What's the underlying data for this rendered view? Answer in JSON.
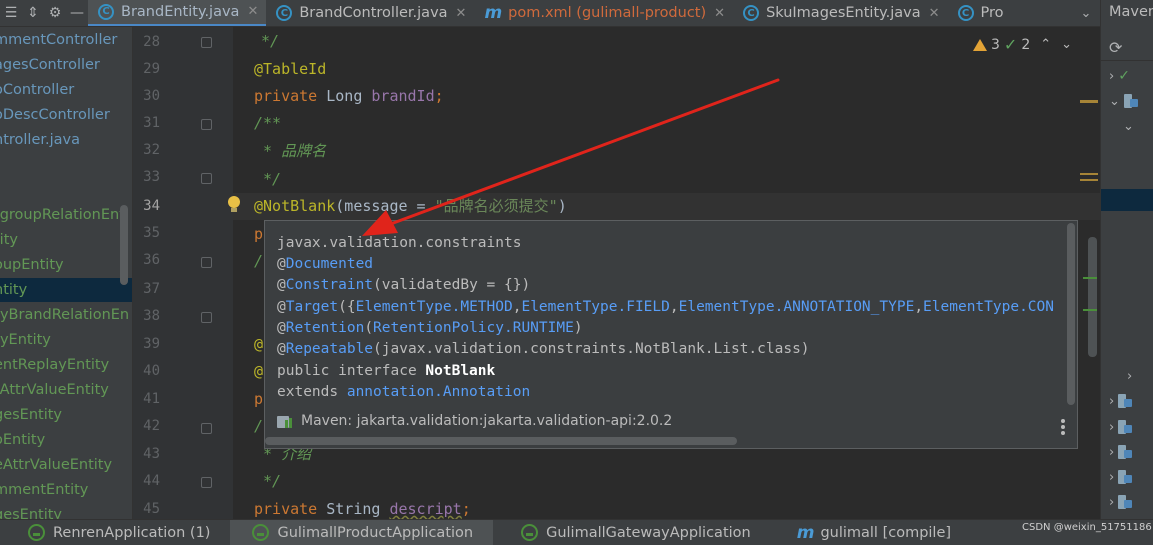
{
  "tabs": [
    {
      "label": "BrandEntity.java",
      "icon": "c-class-icon",
      "active": true
    },
    {
      "label": "BrandController.java",
      "icon": "c-class-icon",
      "active": false
    },
    {
      "label": "pom.xml (gulimall-product)",
      "icon": "maven-m-icon",
      "active": false
    },
    {
      "label": "SkuImagesEntity.java",
      "icon": "c-class-icon",
      "active": false
    },
    {
      "label": "Pro",
      "icon": "c-class-icon",
      "active": false
    }
  ],
  "project_items": [
    {
      "label": "mmentController",
      "color": "blue"
    },
    {
      "label": "agesController",
      "color": "blue"
    },
    {
      "label": "oController",
      "color": "blue"
    },
    {
      "label": "oDescController",
      "color": "blue"
    },
    {
      "label": "ntroller.java",
      "color": "blue"
    },
    {
      "label": "",
      "color": "blue"
    },
    {
      "label": "",
      "color": "blue"
    },
    {
      "label": "rgroupRelationEnt",
      "color": "green"
    },
    {
      "label": "tity",
      "color": "green"
    },
    {
      "label": "oupEntity",
      "color": "green"
    },
    {
      "label": "ntity",
      "color": "green"
    },
    {
      "label": "ryBrandRelationEn",
      "color": "green"
    },
    {
      "label": "ryEntity",
      "color": "green"
    },
    {
      "label": "entReplayEntity",
      "color": "green"
    },
    {
      "label": "tAttrValueEntity",
      "color": "green"
    },
    {
      "label": "gesEntity",
      "color": "green"
    },
    {
      "label": "oEntity",
      "color": "green"
    },
    {
      "label": "eAttrValueEntity",
      "color": "green"
    },
    {
      "label": "mmentEntity",
      "color": "green"
    },
    {
      "label": "gesEntity",
      "color": "green"
    }
  ],
  "line_numbers": [
    "28",
    "29",
    "30",
    "31",
    "32",
    "33",
    "34",
    "35",
    "36",
    "37",
    "38",
    "39",
    "40",
    "41",
    "42",
    "43",
    "44",
    "45"
  ],
  "current_line": "34",
  "code": {
    "l28": "*/",
    "l29": "@TableId",
    "l30_kw": "private",
    "l30_type": " Long ",
    "l30_field": "brandId",
    "l30_end": ";",
    "l31": "/**",
    "l32": " * 品牌名",
    "l33": " */",
    "l34_ann": "@NotBlank",
    "l34_rest": "(message = ",
    "l34_str": "\"品牌名必须提交\"",
    "l34_end": ")",
    "l35": "p",
    "l36": "/",
    "l39": "@",
    "l40": "@",
    "l41": "p",
    "l42": "/",
    "l43": " * 介绍",
    "l44": " */",
    "l45_kw": "private",
    "l45_type": " String ",
    "l45_field": "descript",
    "l45_end": ";"
  },
  "inspection": {
    "warnings": "3",
    "checks": "2"
  },
  "doc": {
    "package": "javax.validation.constraints",
    "at1": "@",
    "documented": "Documented",
    "at2": "@",
    "constraint": "Constraint",
    "constraint_args": "(validatedBy = {})",
    "at3": "@",
    "target": "Target",
    "target_open": "({",
    "et_method": "ElementType.METHOD",
    "comma1": ",",
    "et_field": "ElementType.FIELD",
    "comma2": ",",
    "et_annotation_type": "ElementType.ANNOTATION_TYPE",
    "comma3": ",",
    "et_con": "ElementType.CON",
    "at4": "@",
    "retention": "Retention",
    "retention_open": "(",
    "retention_policy": "RetentionPolicy.RUNTIME",
    "retention_close": ")",
    "at5": "@",
    "repeatable": "Repeatable",
    "repeatable_args": "(javax.validation.constraints.NotBlank.List.class)",
    "decl_prefix": "public interface ",
    "decl_name": "NotBlank",
    "extends_kw": "extends ",
    "extends_target": "annotation.Annotation",
    "footer": "Maven: jakarta.validation:jakarta.validation-api:2.0.2"
  },
  "maven_panel": {
    "title": "Maven"
  },
  "run_tabs": [
    {
      "label": "RenrenApplication (1)",
      "icon": "spring-run-icon"
    },
    {
      "label": "GulimallProductApplication",
      "icon": "spring-run-icon"
    },
    {
      "label": "GulimallGatewayApplication",
      "icon": "spring-run-icon"
    },
    {
      "label": "gulimall [compile]",
      "icon": "maven-m-icon"
    }
  ],
  "watermark": "CSDN @weixin_51751186",
  "colors": {
    "arrow": "#e0241b",
    "accent": "#4a88c7"
  }
}
